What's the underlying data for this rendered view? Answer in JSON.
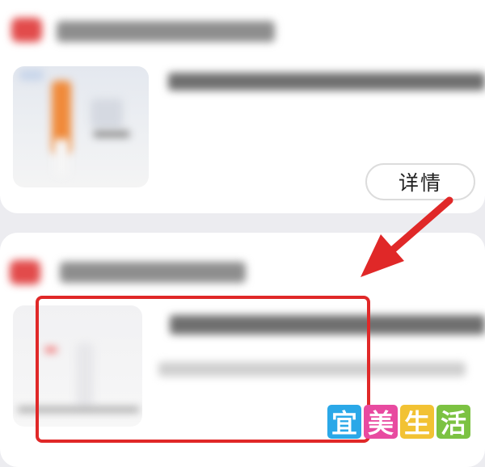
{
  "card1": {
    "store_icon": "shop-logo-icon",
    "detail_button_label": "详情"
  },
  "card2": {
    "store_icon": "shop-logo-icon"
  },
  "annotation": {
    "arrow_color": "#e02828",
    "highlight_color": "#e02828"
  },
  "watermark": {
    "chars": [
      "宜",
      "美",
      "生",
      "活"
    ],
    "colors": [
      "#2aa8e8",
      "#e84aa0",
      "#f2c233",
      "#7cc242"
    ]
  }
}
